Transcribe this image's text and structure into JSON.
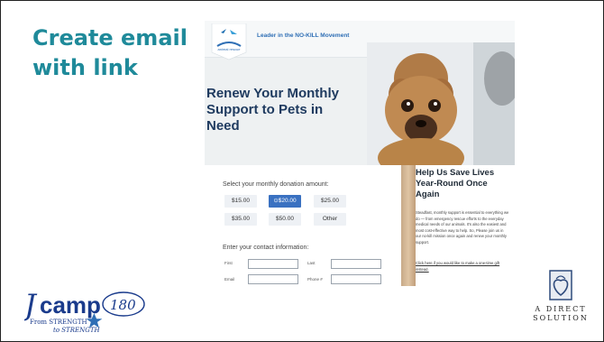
{
  "slide": {
    "title": "Create email with link"
  },
  "email": {
    "tagline": "Leader in the NO-KILL Movement",
    "heading": "Renew Your Monthly Support to Pets in Need",
    "form": {
      "amount_prompt": "Select your monthly donation amount:",
      "amounts": [
        "$15.00",
        "$20.00",
        "$25.00",
        "$35.00",
        "$50.00",
        "Other"
      ],
      "selected": "$20.00",
      "contact_prompt": "Enter your contact information:",
      "labels": {
        "first": "First",
        "last": "Last",
        "email": "Email",
        "phone": "Phone #"
      }
    },
    "panel": {
      "heading": "Help Us Save Lives Year-Round Once Again",
      "body": "Steadfast, monthly support is essential to everything we do — from emergency rescue efforts to the everyday medical needs of our animals. It's also the easiest and most cost-effective way to help. So, Please join us in our no-kill mission once again and renew your monthly support.",
      "link": "Click here if you would like to make a one-time gift instead."
    }
  },
  "footer": {
    "jcamp_word": "camp",
    "jcamp_180": "180",
    "jcamp_line1": "From STRENGTH",
    "jcamp_line2": "to STRENGTH",
    "ads_line1": "A DIRECT",
    "ads_line2": "SOLUTION"
  },
  "colors": {
    "title": "#1f8a9a",
    "accent": "#3a71c1",
    "heading": "#1e3a5f"
  }
}
